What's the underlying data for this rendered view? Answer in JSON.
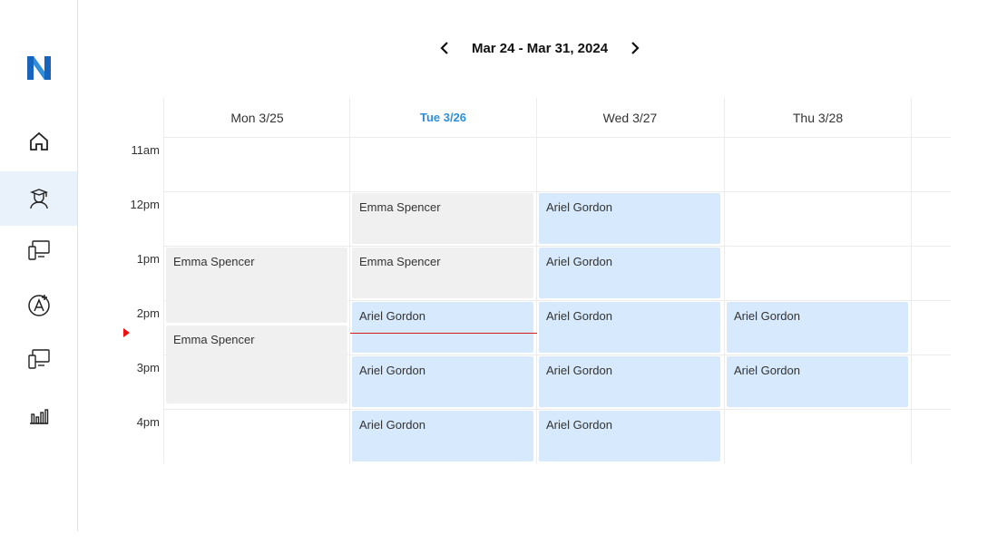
{
  "header": {
    "range_label": "Mar 24 - Mar 31, 2024",
    "prev_icon": "chevron-left-icon",
    "next_icon": "chevron-right-icon"
  },
  "sidebar": {
    "logo": "N",
    "items": [
      {
        "name": "home",
        "icon": "home-icon",
        "active": false
      },
      {
        "name": "students",
        "icon": "graduate-icon",
        "active": true
      },
      {
        "name": "devices",
        "icon": "devices-icon",
        "active": false
      },
      {
        "name": "apps",
        "icon": "app-store-icon",
        "active": false
      },
      {
        "name": "devices-2",
        "icon": "devices-icon",
        "active": false
      },
      {
        "name": "reports",
        "icon": "bar-chart-icon",
        "active": false
      }
    ]
  },
  "days": [
    {
      "label": "Mon 3/25",
      "today": false
    },
    {
      "label": "Tue 3/26",
      "today": true
    },
    {
      "label": "Wed 3/27",
      "today": false
    },
    {
      "label": "Thu 3/28",
      "today": false
    }
  ],
  "times": [
    "11am",
    "12pm",
    "1pm",
    "2pm",
    "3pm",
    "4pm"
  ],
  "events": [
    {
      "day": 0,
      "start": 2,
      "span": 1.45,
      "title": "Emma Spencer",
      "color": "gray"
    },
    {
      "day": 0,
      "start": 3.43,
      "span": 1.5,
      "title": "Emma Spencer",
      "color": "gray"
    },
    {
      "day": 1,
      "start": 1,
      "span": 1,
      "title": "Emma Spencer",
      "color": "gray"
    },
    {
      "day": 1,
      "start": 2,
      "span": 1,
      "title": "Emma Spencer",
      "color": "gray"
    },
    {
      "day": 1,
      "start": 3,
      "span": 1,
      "title": "Ariel Gordon",
      "color": "blue"
    },
    {
      "day": 1,
      "start": 4,
      "span": 1,
      "title": "Ariel Gordon",
      "color": "blue"
    },
    {
      "day": 1,
      "start": 5,
      "span": 1,
      "title": "Ariel Gordon",
      "color": "blue"
    },
    {
      "day": 2,
      "start": 1,
      "span": 1,
      "title": "Ariel Gordon",
      "color": "blue"
    },
    {
      "day": 2,
      "start": 2,
      "span": 1,
      "title": "Ariel Gordon",
      "color": "blue"
    },
    {
      "day": 2,
      "start": 3,
      "span": 1,
      "title": "Ariel Gordon",
      "color": "blue"
    },
    {
      "day": 2,
      "start": 4,
      "span": 1,
      "title": "Ariel Gordon",
      "color": "blue"
    },
    {
      "day": 2,
      "start": 5,
      "span": 1,
      "title": "Ariel Gordon",
      "color": "blue"
    },
    {
      "day": 3,
      "start": 3,
      "span": 1,
      "title": "Ariel Gordon",
      "color": "blue"
    },
    {
      "day": 3,
      "start": 4,
      "span": 1,
      "title": "Ariel Gordon",
      "color": "blue"
    }
  ],
  "now_indicator": {
    "day": 1,
    "slot_offset": 3.6
  },
  "colors": {
    "accent": "#2f8fdb",
    "event_blue": "#d7e9fc",
    "event_gray": "#f0f0f0",
    "now_line": "#d81b1b",
    "logo": "#1565c0"
  }
}
